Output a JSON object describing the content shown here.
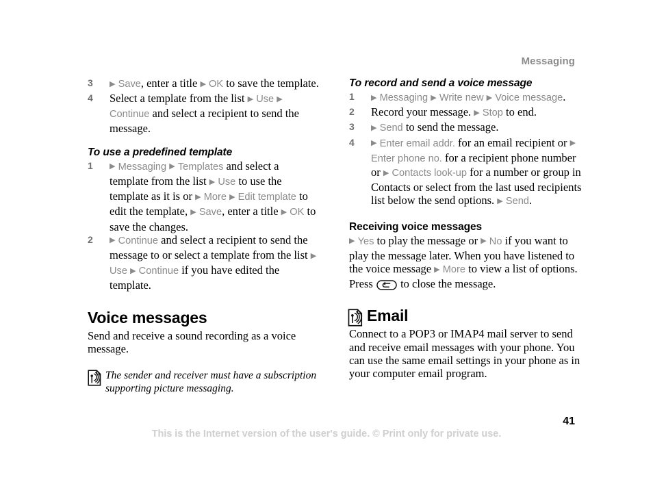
{
  "document": {
    "running_head": "Messaging",
    "page_number": "41",
    "footer_note": "This is the Internet version of the user's guide. © Print only for private use."
  },
  "icons": {
    "note_signal": "signal-note-icon",
    "email_signal": "signal-note-icon",
    "back_key": "back-key-icon",
    "bullet_arrow": "▶"
  },
  "left_column": {
    "continued_steps": [
      {
        "num": "3",
        "parts": [
          {
            "type": "arrow",
            "text": "▶"
          },
          {
            "type": "cmd",
            "text": "Save"
          },
          {
            "type": "text",
            "text": ", enter a title "
          },
          {
            "type": "arrow",
            "text": "▶"
          },
          {
            "type": "cmd",
            "text": "OK"
          },
          {
            "type": "text",
            "text": " to save the template."
          }
        ]
      },
      {
        "num": "4",
        "parts": [
          {
            "type": "text",
            "text": "Select a template from the list "
          },
          {
            "type": "arrow",
            "text": "▶"
          },
          {
            "type": "cmd",
            "text": "Use"
          },
          {
            "type": "text",
            "text": " "
          },
          {
            "type": "arrow",
            "text": "▶"
          },
          {
            "type": "cmd",
            "text": "Continue"
          },
          {
            "type": "text",
            "text": " and select a recipient to send the message."
          }
        ]
      }
    ],
    "predefined_template": {
      "heading": "To use a predefined template",
      "steps": [
        {
          "num": "1",
          "parts": [
            {
              "type": "arrow",
              "text": "▶"
            },
            {
              "type": "cmd",
              "text": "Messaging"
            },
            {
              "type": "text",
              "text": " "
            },
            {
              "type": "arrow",
              "text": "▶"
            },
            {
              "type": "cmd",
              "text": "Templates"
            },
            {
              "type": "text",
              "text": " and select a template from the list "
            },
            {
              "type": "arrow",
              "text": "▶"
            },
            {
              "type": "cmd",
              "text": "Use"
            },
            {
              "type": "text",
              "text": " to use the template as it is or "
            },
            {
              "type": "arrow",
              "text": "▶"
            },
            {
              "type": "cmd",
              "text": "More"
            },
            {
              "type": "text",
              "text": " "
            },
            {
              "type": "arrow",
              "text": "▶"
            },
            {
              "type": "cmd",
              "text": "Edit template"
            },
            {
              "type": "text",
              "text": " to edit the template, "
            },
            {
              "type": "arrow",
              "text": "▶"
            },
            {
              "type": "cmd",
              "text": "Save"
            },
            {
              "type": "text",
              "text": ", enter a title "
            },
            {
              "type": "arrow",
              "text": "▶"
            },
            {
              "type": "cmd",
              "text": "OK"
            },
            {
              "type": "text",
              "text": " to save the changes."
            }
          ]
        },
        {
          "num": "2",
          "parts": [
            {
              "type": "arrow",
              "text": "▶"
            },
            {
              "type": "cmd",
              "text": "Continue"
            },
            {
              "type": "text",
              "text": " and select a recipient to send the message to or select a template from the list "
            },
            {
              "type": "arrow",
              "text": "▶"
            },
            {
              "type": "cmd",
              "text": "Use"
            },
            {
              "type": "text",
              "text": " "
            },
            {
              "type": "arrow",
              "text": "▶"
            },
            {
              "type": "cmd",
              "text": "Continue"
            },
            {
              "type": "text",
              "text": " if you have edited the template."
            }
          ]
        }
      ]
    },
    "voice_messages": {
      "heading": "Voice messages",
      "body": "Send and receive a sound recording as a voice message.",
      "note": "The sender and receiver must have a subscription supporting picture messaging."
    }
  },
  "right_column": {
    "record_send": {
      "heading": "To record and send a voice message",
      "steps": [
        {
          "num": "1",
          "parts": [
            {
              "type": "arrow",
              "text": "▶"
            },
            {
              "type": "cmd",
              "text": "Messaging"
            },
            {
              "type": "text",
              "text": " "
            },
            {
              "type": "arrow",
              "text": "▶"
            },
            {
              "type": "cmd",
              "text": "Write new"
            },
            {
              "type": "text",
              "text": " "
            },
            {
              "type": "arrow",
              "text": "▶"
            },
            {
              "type": "cmd",
              "text": "Voice message"
            },
            {
              "type": "text",
              "text": "."
            }
          ]
        },
        {
          "num": "2",
          "parts": [
            {
              "type": "text",
              "text": "Record your message. "
            },
            {
              "type": "arrow",
              "text": "▶"
            },
            {
              "type": "cmd",
              "text": "Stop"
            },
            {
              "type": "text",
              "text": " to end."
            }
          ]
        },
        {
          "num": "3",
          "parts": [
            {
              "type": "arrow",
              "text": "▶"
            },
            {
              "type": "cmd",
              "text": "Send"
            },
            {
              "type": "text",
              "text": " to send the message."
            }
          ]
        },
        {
          "num": "4",
          "parts": [
            {
              "type": "arrow",
              "text": "▶"
            },
            {
              "type": "cmd",
              "text": "Enter email addr."
            },
            {
              "type": "text",
              "text": " for an email recipient or "
            },
            {
              "type": "arrow",
              "text": "▶"
            },
            {
              "type": "cmd",
              "text": "Enter phone no."
            },
            {
              "type": "text",
              "text": " for a recipient phone number or "
            },
            {
              "type": "arrow",
              "text": "▶"
            },
            {
              "type": "cmd",
              "text": "Contacts look-up"
            },
            {
              "type": "text",
              "text": " for a number or group in Contacts or select from the last used recipients list below the send options. "
            },
            {
              "type": "arrow",
              "text": "▶"
            },
            {
              "type": "cmd",
              "text": "Send"
            },
            {
              "type": "text",
              "text": "."
            }
          ]
        }
      ]
    },
    "receiving": {
      "heading": "Receiving voice messages",
      "parts_before_key": [
        {
          "type": "arrow",
          "text": "▶"
        },
        {
          "type": "cmd",
          "text": "Yes"
        },
        {
          "type": "text",
          "text": " to play the message or "
        },
        {
          "type": "arrow",
          "text": "▶"
        },
        {
          "type": "cmd",
          "text": "No"
        },
        {
          "type": "text",
          "text": " if you want to play the message later. When you have listened to the voice message "
        },
        {
          "type": "arrow",
          "text": "▶"
        },
        {
          "type": "cmd",
          "text": "More"
        },
        {
          "type": "text",
          "text": " to view a list of options. Press "
        }
      ],
      "parts_after_key": [
        {
          "type": "text",
          "text": " to close the message."
        }
      ]
    },
    "email": {
      "heading": "Email",
      "body": "Connect to a POP3 or IMAP4 mail server to send and receive email messages with your phone. You can use the same email settings in your phone as in your computer email program."
    }
  }
}
